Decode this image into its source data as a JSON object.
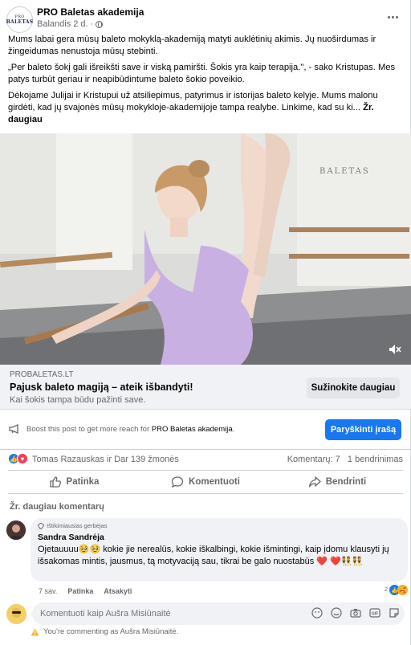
{
  "post": {
    "page_name": "PRO Baletas akademija",
    "date": "Balandis 2 d.",
    "logo_line1": "PRO",
    "logo_line2": "BALETAS",
    "paragraphs": [
      "Mums labai gera mūsų baleto mokyklą-akademiją matyti auklėtinių akimis. Jų nuoširdumas ir žingeidumas nenustoja mūsų stebinti.",
      "„Per baleto šokį gali išreikšti save ir viską pamiršti. Šokis yra kaip terapija.\", - sako Kristupas.  Mes patys turbūt geriau ir neapibūdintume baleto šokio poveikio.",
      "Dėkojame Julijai ir Kristupui už atsiliepimus, patyrimus ir istorijas baleto kelyje. Mums malonu girdėti, kad jų svajonės mūsų mokykloje-akademijoje tampa realybe. Linkime, kad su ki... "
    ],
    "see_more": "Žr. daugiau",
    "photo_sign": "BALETAS"
  },
  "link": {
    "domain": "PROBALETAS.LT",
    "title": "Pajusk baleto magiją – ateik išbandyti!",
    "description": "Kai šokis tampa būdu pažinti save.",
    "button": "Sužinokite daugiau"
  },
  "boost": {
    "text_prefix": "Boost this post to get more reach for ",
    "page": "PRO Baletas akademija",
    "text_suffix": ".",
    "button": "Paryškinti įrašą"
  },
  "stats": {
    "reactions": "Tomas Razauskas ir Dar 139 žmonės",
    "comments": "Komentarų: 7",
    "shares": "1 bendrinimas"
  },
  "actions": {
    "like": "Patinka",
    "comment": "Komentuoti",
    "share": "Bendrinti"
  },
  "comments_section": {
    "see_more": "Žr. daugiau komentarų",
    "comment": {
      "badge": "Ištikimiausias gerbėjas",
      "author": "Sandra Sandrėja",
      "text": "Ojetauuuu🥹🥹 kokie jie nerealūs, kokie iškalbingi, kokie išmintingi, kaip įdomu klausyti jų išsakomas mintis, jausmus, tą motyvaciją sau, tikrai be galo nuostabūs ❤️ ❤️👯👯",
      "age": "7 sav.",
      "like": "Patinka",
      "reply": "Atsakyti",
      "reaction_count": "2"
    }
  },
  "composer": {
    "placeholder": "Komentuoti kaip Aušra Misiūnaitė",
    "notice": "You're commenting as Aušra Misiūnaitė."
  },
  "colors": {
    "primary": "#1877f2",
    "love": "#f33e58",
    "secondary_text": "#65676b",
    "surface": "#f0f2f5"
  }
}
